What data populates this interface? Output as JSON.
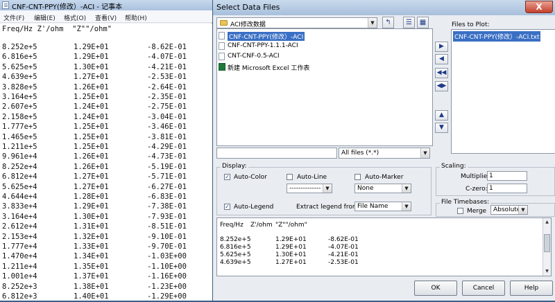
{
  "notepad": {
    "title": "CNF-CNT-PPY(修改）-ACI - 记事本",
    "menu": [
      "文件(F)",
      "编辑(E)",
      "格式(O)",
      "查看(V)",
      "帮助(H)"
    ],
    "header": "Freq/Hz Z'/ohm  \"Z\"\"/ohm\"",
    "rows": [
      [
        "8.252e+5",
        "1.29E+01",
        "-8.62E-01"
      ],
      [
        "6.816e+5",
        "1.29E+01",
        "-4.07E-01"
      ],
      [
        "5.625e+5",
        "1.30E+01",
        "-4.21E-01"
      ],
      [
        "4.639e+5",
        "1.27E+01",
        "-2.53E-01"
      ],
      [
        "3.828e+5",
        "1.26E+01",
        "-2.64E-01"
      ],
      [
        "3.164e+5",
        "1.25E+01",
        "-2.35E-01"
      ],
      [
        "2.607e+5",
        "1.24E+01",
        "-2.75E-01"
      ],
      [
        "2.158e+5",
        "1.24E+01",
        "-3.04E-01"
      ],
      [
        "1.777e+5",
        "1.25E+01",
        "-3.46E-01"
      ],
      [
        "1.465e+5",
        "1.25E+01",
        "-3.81E-01"
      ],
      [
        "1.211e+5",
        "1.25E+01",
        "-4.29E-01"
      ],
      [
        "9.961e+4",
        "1.26E+01",
        "-4.73E-01"
      ],
      [
        "8.252e+4",
        "1.26E+01",
        "-5.19E-01"
      ],
      [
        "6.812e+4",
        "1.27E+01",
        "-5.71E-01"
      ],
      [
        "5.625e+4",
        "1.27E+01",
        "-6.27E-01"
      ],
      [
        "4.644e+4",
        "1.28E+01",
        "-6.83E-01"
      ],
      [
        "3.833e+4",
        "1.29E+01",
        "-7.38E-01"
      ],
      [
        "3.164e+4",
        "1.30E+01",
        "-7.93E-01"
      ],
      [
        "2.612e+4",
        "1.31E+01",
        "-8.51E-01"
      ],
      [
        "2.153e+4",
        "1.32E+01",
        "-9.10E-01"
      ],
      [
        "1.777e+4",
        "1.33E+01",
        "-9.70E-01"
      ],
      [
        "1.470e+4",
        "1.34E+01",
        "-1.03E+00"
      ],
      [
        "1.211e+4",
        "1.35E+01",
        "-1.10E+00"
      ],
      [
        "1.001e+4",
        "1.37E+01",
        "-1.16E+00"
      ],
      [
        "8.252e+3",
        "1.38E+01",
        "-1.23E+00"
      ],
      [
        "6.812e+3",
        "1.40E+01",
        "-1.29E+00"
      ]
    ]
  },
  "dialog": {
    "title": "Select Data Files",
    "close_glyph": "X",
    "folder": "ACI修改数据",
    "files": [
      {
        "name": "CNF-CNT-PPY(修改）-ACI",
        "selected": true,
        "icon": "file-icon"
      },
      {
        "name": "CNF-CNT-PPY-1.1.1-ACI",
        "selected": false,
        "icon": "file-icon"
      },
      {
        "name": "CNT-CNF-0.5-ACI",
        "selected": false,
        "icon": "file-icon"
      },
      {
        "name": "新建 Microsoft Excel 工作表",
        "selected": false,
        "icon": "excel-icon"
      }
    ],
    "files_to_plot_label": "Files to Plot:",
    "files_to_plot": [
      "CNF-CNT-PPY(修改）-ACI.txt"
    ],
    "filter": "All files (*.*)",
    "display": {
      "label": "Display:",
      "auto_color": "Auto-Color",
      "auto_color_checked": true,
      "auto_line": "Auto-Line",
      "auto_line_checked": false,
      "auto_marker": "Auto-Marker",
      "auto_marker_checked": false,
      "line_style": "--------------",
      "marker": "None",
      "auto_legend": "Auto-Legend",
      "auto_legend_checked": true,
      "extract_legend_label": "Extract legend from:",
      "extract_legend_value": "File Name"
    },
    "scaling": {
      "label": "Scaling:",
      "multiplier_label": "Multiplier:",
      "multiplier": "1",
      "czero_label": "C-zero:",
      "czero": "1"
    },
    "timebases": {
      "label": "File Timebases:",
      "merge": "Merge",
      "merge_checked": false,
      "mode": "Absolute"
    },
    "preview": {
      "header": [
        "Freq/Hz",
        "Z'/ohm",
        "\"Z\"\"/ohm\""
      ],
      "rows": [
        [
          "8.252e+5",
          "1.29E+01",
          "-8.62E-01"
        ],
        [
          "6.816e+5",
          "1.29E+01",
          "-4.07E-01"
        ],
        [
          "5.625e+5",
          "1.30E+01",
          "-4.21E-01"
        ],
        [
          "4.639e+5",
          "1.27E+01",
          "-2.53E-01"
        ]
      ]
    },
    "buttons": {
      "ok": "OK",
      "cancel": "Cancel",
      "help": "Help"
    }
  }
}
